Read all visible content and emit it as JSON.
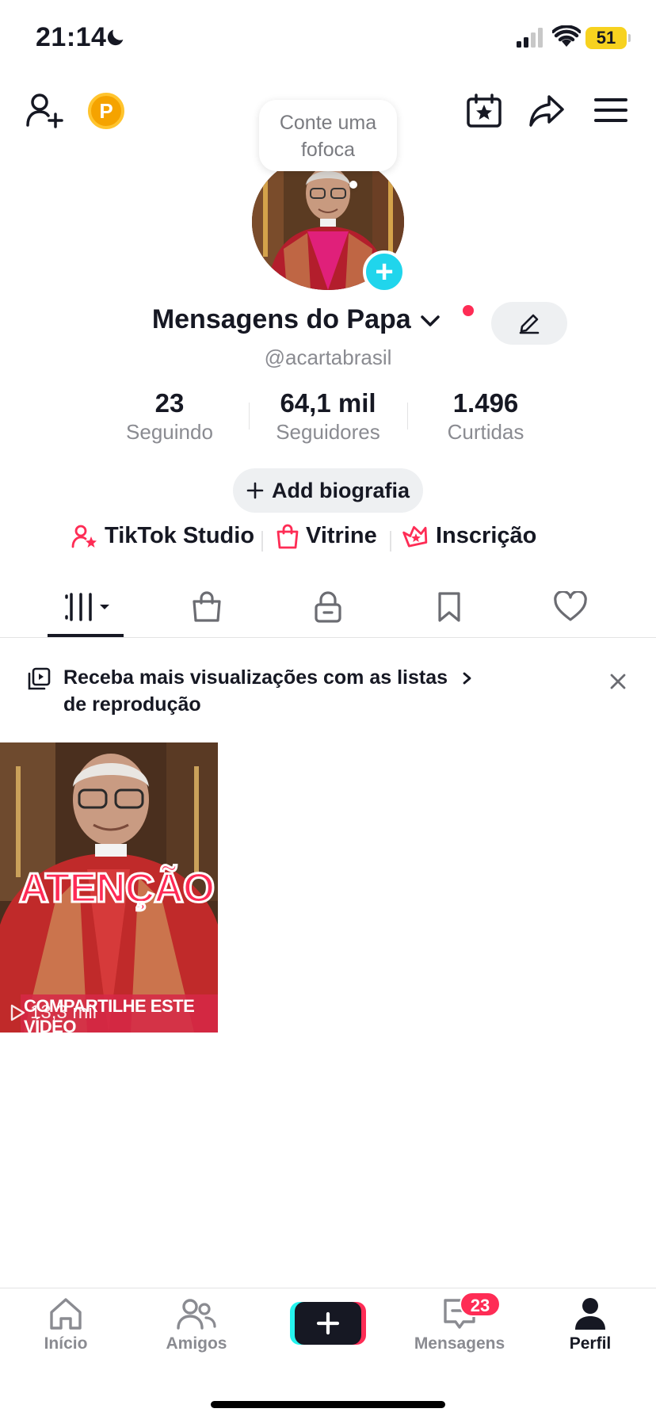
{
  "status_bar": {
    "time": "21:14",
    "battery": "51"
  },
  "header": {
    "add_friend_icon": "person-add-icon",
    "coin_letter": "P",
    "calendar_icon": "calendar-star-icon",
    "share_icon": "share-arrow-icon",
    "menu_icon": "hamburger-menu-icon"
  },
  "bubble": {
    "text_line1": "Conte uma",
    "text_line2": "fofoca"
  },
  "profile": {
    "name": "Mensagens do Papa",
    "handle": "@acartabrasil",
    "stats": [
      {
        "value": "23",
        "label": "Seguindo"
      },
      {
        "value": "64,1 mil",
        "label": "Seguidores"
      },
      {
        "value": "1.496",
        "label": "Curtidas"
      }
    ],
    "bio_button": "Add biografia"
  },
  "links": [
    {
      "label": "TikTok Studio",
      "icon": "person-star-icon"
    },
    {
      "label": "Vitrine",
      "icon": "shopping-bag-icon"
    },
    {
      "label": "Inscrição",
      "icon": "crown-star-icon"
    }
  ],
  "tabs": [
    {
      "icon": "videos-grid-icon"
    },
    {
      "icon": "shopping-bag-icon"
    },
    {
      "icon": "lock-icon"
    },
    {
      "icon": "bookmark-icon"
    },
    {
      "icon": "heart-icon"
    }
  ],
  "playlist_banner": {
    "line1": "Receba mais visualizações com as listas",
    "line2": "de reprodução"
  },
  "videos": [
    {
      "overlay_title": "ATENÇÃO",
      "caption": "COMPARTILHE ESTE VÍDEO",
      "views": "13,3 mil"
    }
  ],
  "bottom_nav": {
    "items": [
      {
        "label": "Início",
        "icon": "home-icon"
      },
      {
        "label": "Amigos",
        "icon": "friends-icon"
      },
      {
        "label": "",
        "icon": "create-plus-icon"
      },
      {
        "label": "Mensagens",
        "icon": "message-icon",
        "badge": "23"
      },
      {
        "label": "Perfil",
        "icon": "person-icon"
      }
    ]
  },
  "colors": {
    "accent": "#fe2c55",
    "cyan": "#20d5ec",
    "text": "#161823",
    "muted": "#8a8b91"
  }
}
